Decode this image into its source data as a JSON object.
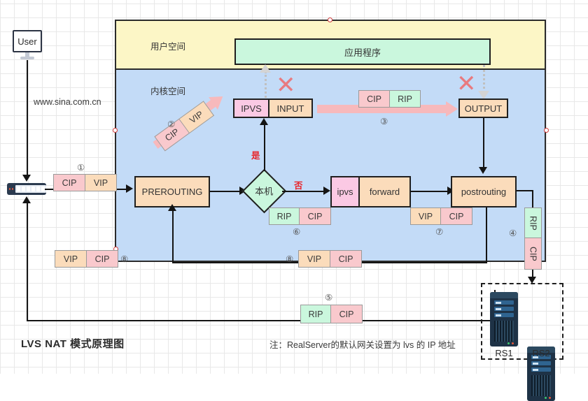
{
  "diagram": {
    "title": "LVS NAT 模式原理图",
    "note": "注：RealServer的默认网关设置为 lvs 的 IP 地址"
  },
  "zones": {
    "user_space": "用户空间",
    "kernel_space": "内核空间"
  },
  "nodes": {
    "user_terminal": "User",
    "domain": "www.sina.com.cn",
    "application": "应用程序",
    "ipvs_input_left": "IPVS",
    "ipvs_input_right": "INPUT",
    "output": "OUTPUT",
    "prerouting": "PREROUTING",
    "local_decision": "本机",
    "ipvs_fw_left": "ipvs",
    "ipvs_fw_right": "forward",
    "postrouting": "postrouting",
    "rs1": "RS1",
    "rs2": "RS2"
  },
  "decision_labels": {
    "yes": "是",
    "no": "否"
  },
  "packets": [
    {
      "id": "p1",
      "num": "①",
      "cells": [
        {
          "text": "CIP",
          "kind": "cip"
        },
        {
          "text": "VIP",
          "kind": "vip"
        }
      ]
    },
    {
      "id": "p2",
      "num": "②",
      "cells": [
        {
          "text": "CIP",
          "kind": "cip"
        },
        {
          "text": "VIP",
          "kind": "vip"
        }
      ]
    },
    {
      "id": "p3",
      "num": "③",
      "cells": [
        {
          "text": "CIP",
          "kind": "cip"
        },
        {
          "text": "RIP",
          "kind": "rip"
        }
      ]
    },
    {
      "id": "p4",
      "num": "④",
      "cells": [
        {
          "text": "RIP",
          "kind": "rip"
        },
        {
          "text": "CIP",
          "kind": "cip"
        }
      ]
    },
    {
      "id": "p5",
      "num": "⑤",
      "cells": [
        {
          "text": "RIP",
          "kind": "rip"
        },
        {
          "text": "CIP",
          "kind": "cip"
        }
      ]
    },
    {
      "id": "p6",
      "num": "⑥",
      "cells": [
        {
          "text": "RIP",
          "kind": "rip"
        },
        {
          "text": "CIP",
          "kind": "cip"
        }
      ]
    },
    {
      "id": "p7",
      "num": "⑦",
      "cells": [
        {
          "text": "VIP",
          "kind": "vip"
        },
        {
          "text": "CIP",
          "kind": "cip"
        }
      ]
    },
    {
      "id": "p8a",
      "num": "⑧",
      "cells": [
        {
          "text": "VIP",
          "kind": "vip"
        },
        {
          "text": "CIP",
          "kind": "cip"
        }
      ]
    },
    {
      "id": "p8b",
      "num": "⑧",
      "cells": [
        {
          "text": "VIP",
          "kind": "vip"
        },
        {
          "text": "CIP",
          "kind": "cip"
        }
      ]
    }
  ],
  "packet_text": {
    "p1_c0": "CIP",
    "p1_c1": "VIP",
    "p2_c0": "CIP",
    "p2_c1": "VIP",
    "p3_c0": "CIP",
    "p3_c1": "RIP",
    "p4_c0": "RIP",
    "p4_c1": "CIP",
    "p5_c0": "RIP",
    "p5_c1": "CIP",
    "p6_c0": "RIP",
    "p6_c1": "CIP",
    "p7_c0": "VIP",
    "p7_c1": "CIP",
    "p8a_c0": "VIP",
    "p8a_c1": "CIP",
    "p8b_c0": "VIP",
    "p8b_c1": "CIP"
  },
  "numbers": {
    "n1": "①",
    "n2": "②",
    "n3": "③",
    "n4": "④",
    "n5": "⑤",
    "n6": "⑥",
    "n7": "⑦",
    "n8a": "⑧",
    "n8b": "⑧"
  },
  "marks": {
    "x_left": "✕",
    "x_right": "✕"
  },
  "colors": {
    "user_space_fill": "#fcf6c6",
    "kernel_space_fill": "#c3dbf7",
    "app_fill": "#caf7dd",
    "chain_fill": "#fbdcbb",
    "ipvs_fill": "#fbc9e4",
    "cip_fill": "#f9c9cd",
    "vip_fill": "#fbdcbb",
    "rip_fill": "#caf7dd",
    "arrow_pink": "#f7b9bc",
    "red_label": "#e8262b",
    "stroke": "#1f1f1f"
  }
}
